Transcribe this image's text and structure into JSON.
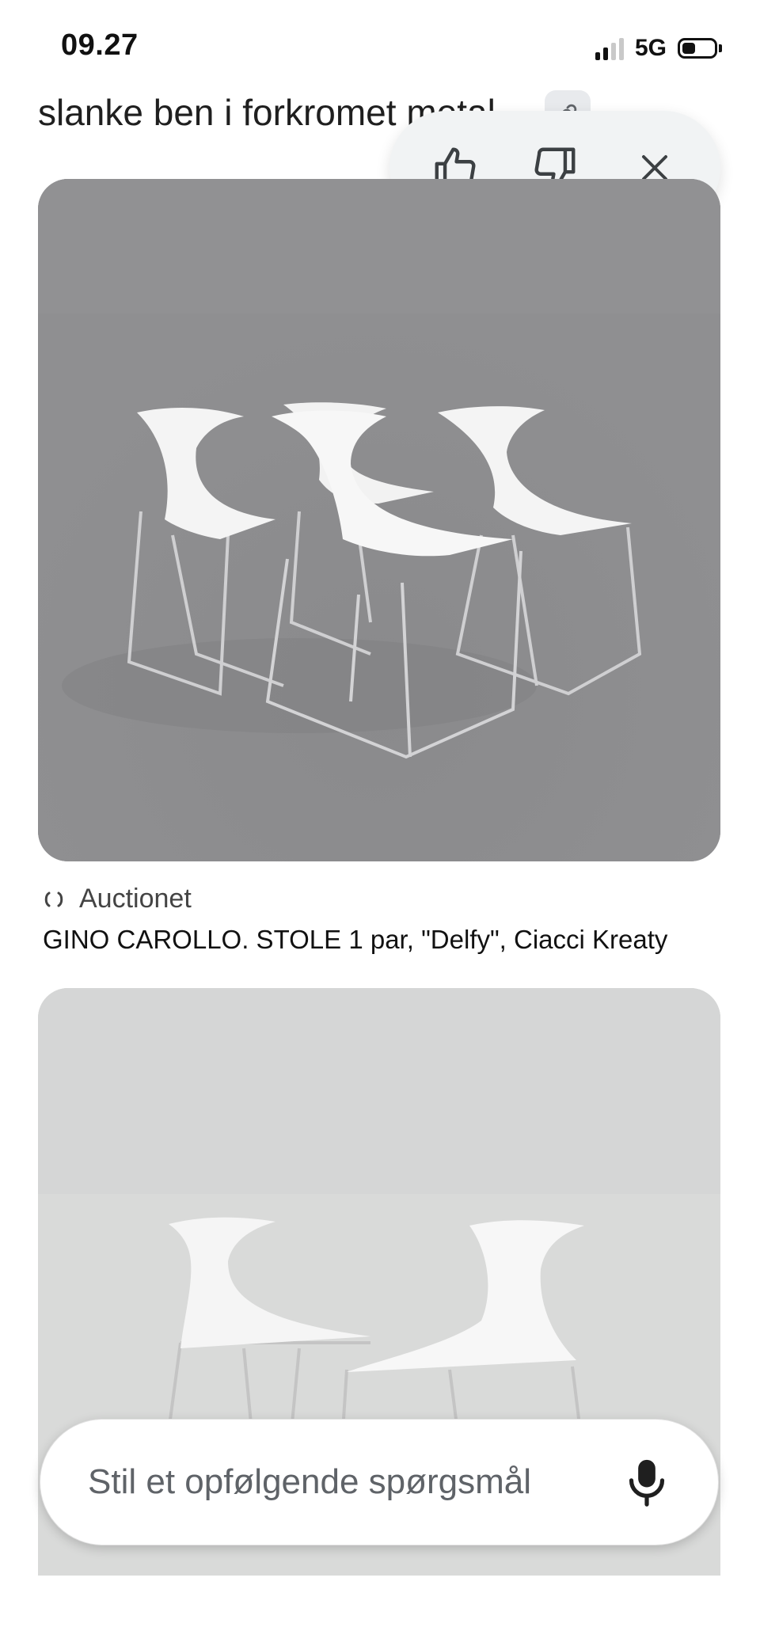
{
  "status": {
    "time": "09.27",
    "network": "5G"
  },
  "query": {
    "text": "slanke ben i forkromet metal"
  },
  "feedback": {
    "like": "thumbs-up-icon",
    "dislike": "thumbs-down-icon",
    "close": "close-icon"
  },
  "result": {
    "source": "Auctionet",
    "title": "GINO CAROLLO. STOLE 1 par, \"Delfy\", Ciacci Kreaty"
  },
  "followup": {
    "placeholder": "Stil et opfølgende spørgsmål"
  },
  "colors": {
    "accent": "#1f1f1f",
    "pill_bg": "#f1f3f4",
    "photo1_bg": "#8e8e90",
    "photo2_bg": "#dcdddc"
  }
}
